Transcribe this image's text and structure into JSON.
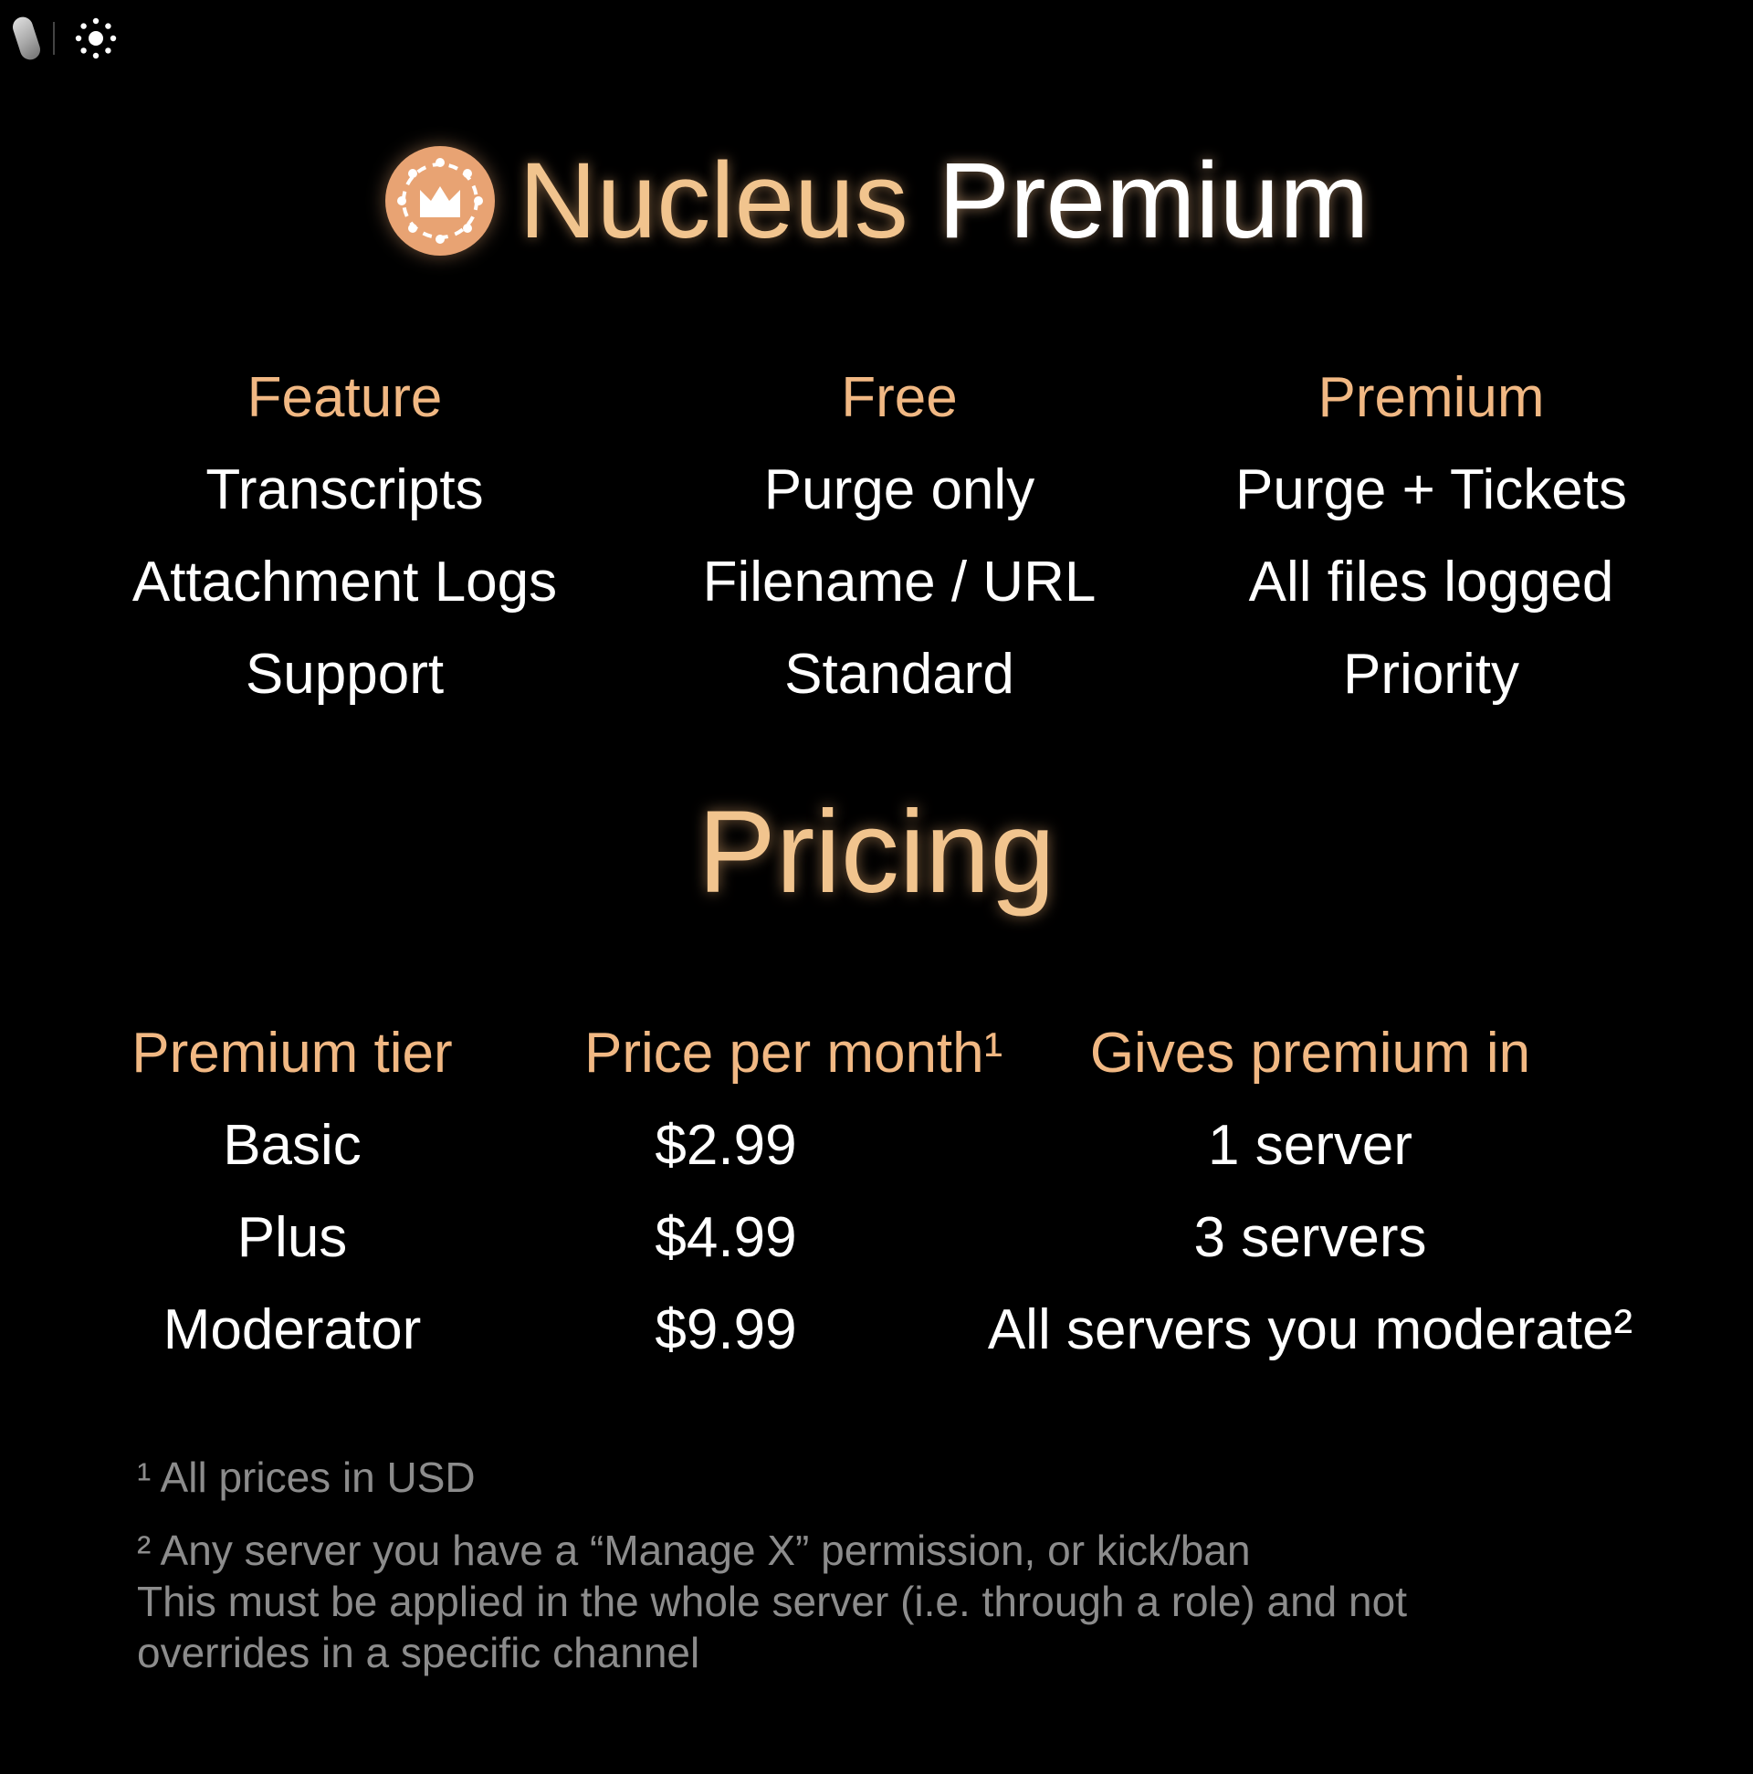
{
  "toolbar": {
    "icons": [
      "pill-icon",
      "gear-icon"
    ]
  },
  "hero": {
    "title_accent": "Nucleus",
    "title_main": "Premium",
    "logo_icon": "crown-ring-icon",
    "logo_color": "#e8a373"
  },
  "compare": {
    "headers": [
      "Feature",
      "Free",
      "Premium"
    ],
    "rows": [
      [
        "Transcripts",
        "Purge only",
        "Purge + Tickets"
      ],
      [
        "Attachment Logs",
        "Filename / URL",
        "All files logged"
      ],
      [
        "Support",
        "Standard",
        "Priority"
      ]
    ]
  },
  "pricing": {
    "title": "Pricing",
    "headers": [
      "Premium tier",
      "Price per month¹",
      "Gives premium in"
    ],
    "rows": [
      [
        "Basic",
        "$2.99",
        "1 server"
      ],
      [
        "Plus",
        "$4.99",
        "3 servers"
      ],
      [
        "Moderator",
        "$9.99",
        "All servers you moderate²"
      ]
    ]
  },
  "notes": {
    "note1": "¹ All prices in USD",
    "note2": [
      "² Any server you have a “Manage X” permission, or kick/ban",
      "This must be applied in the whole server (i.e. through a role) and not",
      "overrides in a specific channel"
    ]
  },
  "colors": {
    "accent": "#f1b883",
    "title_accent": "#f1c48e",
    "text": "#ffffff",
    "muted": "#8c8c8c",
    "background": "#000000"
  }
}
